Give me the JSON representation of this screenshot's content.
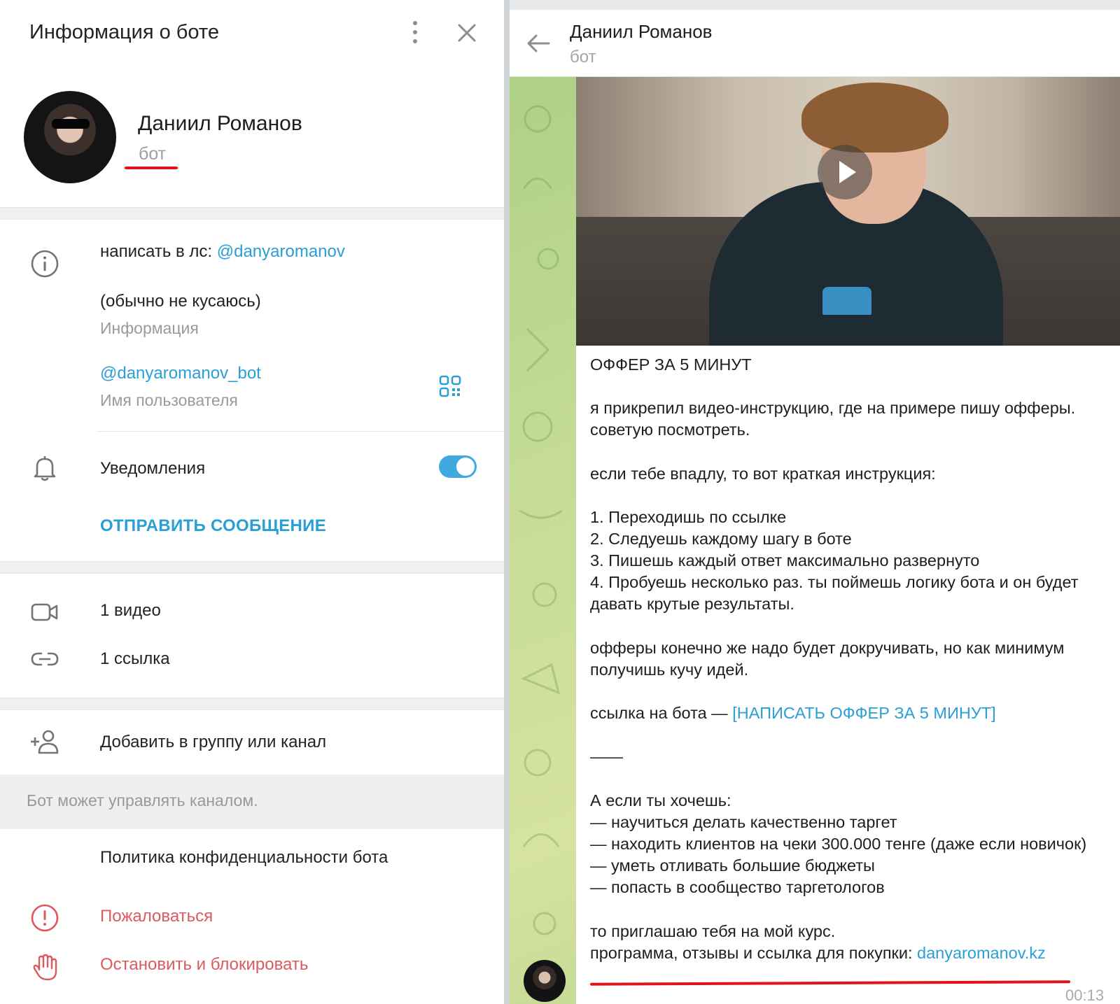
{
  "info_panel": {
    "title": "Информация о боте",
    "profile": {
      "name": "Даниил Романов",
      "subtitle": "бот"
    },
    "bio_line1": "написать в лс: ",
    "bio_link": "@danyaromanov",
    "bio_line2": "(обычно не кусаюсь)",
    "bio_caption": "Информация",
    "username": "@danyaromanov_bot",
    "username_caption": "Имя пользователя",
    "notifications_label": "Уведомления",
    "notifications_on": true,
    "send_message_label": "ОТПРАВИТЬ СООБЩЕНИЕ",
    "media": {
      "video": "1 видео",
      "link": "1 ссылка"
    },
    "add_to_group_label": "Добавить в группу или канал",
    "channel_note": "Бот может управлять каналом.",
    "privacy_label": "Политика конфиденциальности бота",
    "report_label": "Пожаловаться",
    "block_label": "Остановить и блокировать"
  },
  "chat": {
    "header": {
      "name": "Даниил Романов",
      "subtitle": "бот"
    },
    "message": {
      "title": "ОФФЕР ЗА 5 МИНУТ",
      "p1_line1": "я прикрепил видео-инструкцию, где на примере пишу офферы.",
      "p1_line2": "советую посмотреть.",
      "p2": "если тебе впадлу, то вот краткая инструкция:",
      "steps": [
        "1. Переходишь по ссылке",
        "2. Следуешь каждому шагу в боте",
        "3. Пишешь каждый ответ максимально развернуто",
        "4. Пробуешь несколько раз. ты поймешь логику бота и он будет"
      ],
      "step4_cont": "давать крутые результаты.",
      "p3_line1": "офферы конечно же надо будет докручивать, но как минимум",
      "p3_line2": "получишь кучу идей.",
      "bot_link_prefix": "ссылка на бота — ",
      "bot_link": "[НАПИСАТЬ ОФФЕР ЗА 5 МИНУТ]",
      "separator": "——",
      "p4_intro": "А если ты хочешь:",
      "bullets": [
        "— научиться делать качественно таргет",
        "— находить клиентов на чеки 300.000 тенге (даже если новичок)",
        "— уметь отливать большие бюджеты",
        "— попасть в сообщество таргетологов"
      ],
      "invite": "то приглашаю тебя на мой курс.",
      "course_prefix": "программа, отзывы и ссылка для покупки: ",
      "course_link": "danyaromanov.kz",
      "time": "00:13"
    }
  },
  "colors": {
    "accent": "#2a9fd6",
    "danger": "#dc5a5f",
    "annotation_red": "#e1131b",
    "toggle_on": "#3fa9e0"
  },
  "icons": [
    "more-vert-icon",
    "close-icon",
    "info-icon",
    "qr-code-icon",
    "bell-icon",
    "video-icon",
    "link-icon",
    "add-user-icon",
    "report-icon",
    "hand-block-icon",
    "back-arrow-icon",
    "play-icon"
  ]
}
